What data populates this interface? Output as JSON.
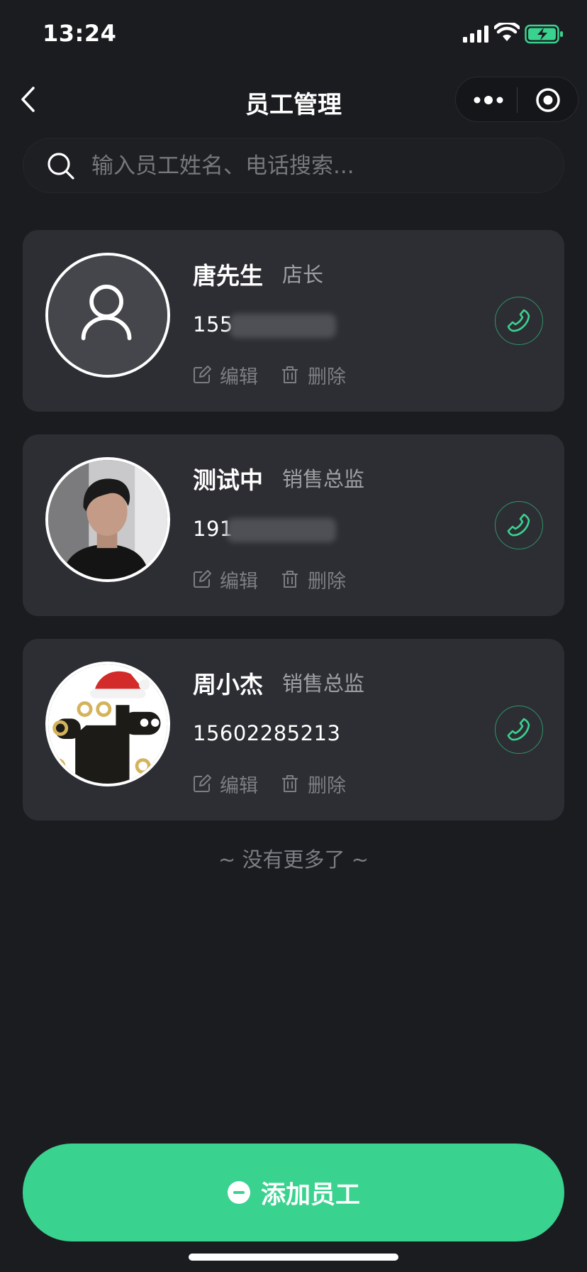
{
  "status_bar": {
    "time": "13:24",
    "icons": [
      "cellular-signal-icon",
      "wifi-icon",
      "battery-charging-icon"
    ]
  },
  "nav": {
    "back_icon": "chevron-left-icon",
    "title": "员工管理",
    "capsule_icons": [
      "more-dots-icon",
      "target-icon"
    ]
  },
  "search": {
    "icon": "search-icon",
    "placeholder": "输入员工姓名、电话搜索...",
    "value": ""
  },
  "employees": [
    {
      "name": "唐先生",
      "role": "店长",
      "phone": "155",
      "phone_masked": true,
      "avatar": "default-user-avatar",
      "edit_label": "编辑",
      "delete_label": "删除"
    },
    {
      "name": "测试中",
      "role": "销售总监",
      "phone": "191",
      "phone_masked": true,
      "avatar": "photo-avatar",
      "edit_label": "编辑",
      "delete_label": "删除"
    },
    {
      "name": "周小杰",
      "role": "销售总监",
      "phone": "15602285213",
      "phone_masked": false,
      "avatar": "christmas-hat-avatar",
      "edit_label": "编辑",
      "delete_label": "删除"
    }
  ],
  "list_end_text": "~ 没有更多了 ~",
  "add_button": {
    "label": "添加员工",
    "icon": "add-circle-icon"
  },
  "colors": {
    "background": "#1b1c20",
    "card": "#2d2e33",
    "accent_green": "#3ad28f",
    "call_green": "#2f9467",
    "muted_text": "#7d7e83",
    "role_text": "#9fa0a4"
  }
}
